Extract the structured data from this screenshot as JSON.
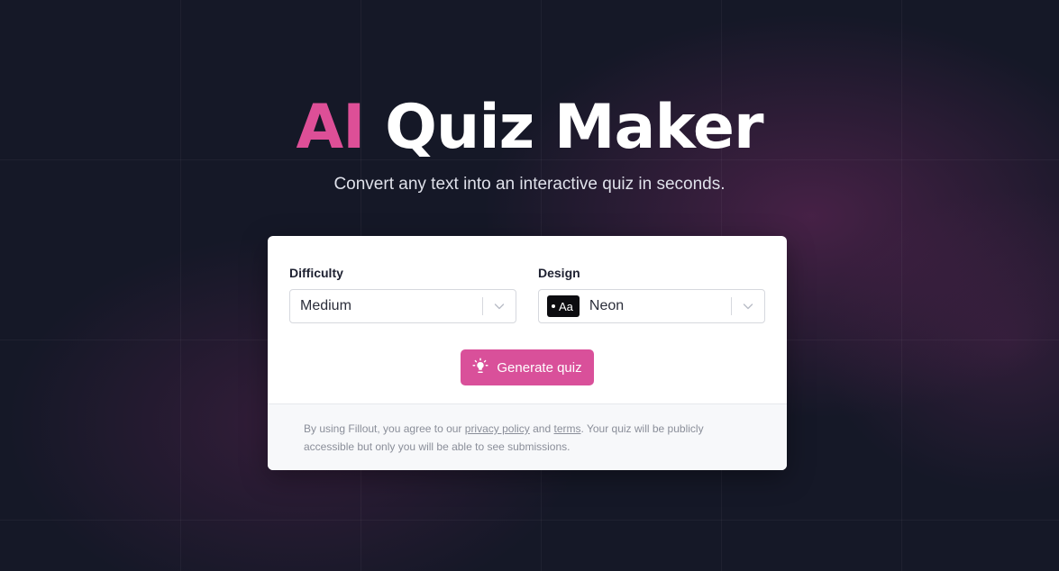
{
  "hero": {
    "title_accent": "AI",
    "title_rest": "Quiz Maker",
    "subtitle": "Convert any text into an interactive quiz in seconds."
  },
  "form": {
    "difficulty": {
      "label": "Difficulty",
      "value": "Medium"
    },
    "design": {
      "label": "Design",
      "chip_text": "Aa",
      "value": "Neon"
    },
    "generate_button": {
      "label": "Generate quiz",
      "icon": "lightbulb-icon"
    }
  },
  "footer": {
    "text_before": "By using Fillout, you agree to our ",
    "privacy_link": "privacy policy",
    "text_and": " and ",
    "terms_link": "terms",
    "text_after": ". Your quiz will be publicly accessible but only you will be able to see submissions."
  },
  "colors": {
    "background": "#151827",
    "accent": "#dd4f97",
    "button": "#d9509a",
    "card": "#ffffff",
    "footer_bg": "#f7f8fa"
  }
}
